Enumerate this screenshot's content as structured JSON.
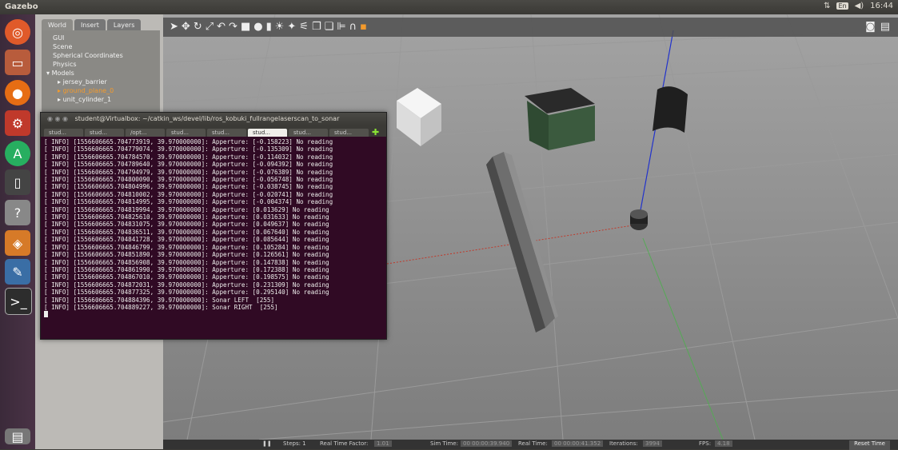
{
  "topbar": {
    "title": "Gazebo",
    "kb": "En",
    "volume": "◀)",
    "time": "16:44"
  },
  "sidebar": {
    "tabs": [
      "World",
      "Insert",
      "Layers"
    ],
    "tree": {
      "items": [
        "GUI",
        "Scene",
        "Spherical Coordinates",
        "Physics"
      ],
      "models_label": "Models",
      "models": [
        "jersey_barrier",
        "ground_plane_0",
        "unit_cylinder_1"
      ]
    }
  },
  "statusbar": {
    "steps": "Steps: 1",
    "rtf_label": "Real Time Factor:",
    "rtf": "1.01",
    "sim_label": "Sim Time:",
    "sim": "00 00:00:39.940",
    "real_label": "Real Time:",
    "real": "00 00:00:41.352",
    "iter_label": "Iterations:",
    "iter": "3994",
    "fps_label": "FPS:",
    "fps": "4.18",
    "reset": "Reset Time"
  },
  "terminal": {
    "title": "student@Virtualbox: ~/catkin_ws/devel/lib/ros_kobuki_fullrangelaserscan_to_sonar",
    "tabs": [
      "stud...",
      "stud...",
      "/opt...",
      "stud...",
      "stud...",
      "stud...",
      "stud...",
      "stud...",
      "stud..."
    ],
    "active_tab": 5,
    "lines": [
      "[ INFO] [1556606665.704773919, 39.970000000]: Apperture: [-0.158223] No reading",
      "[ INFO] [1556606665.704779074, 39.970000000]: Apperture: [-0.135309] No reading",
      "[ INFO] [1556606665.704784570, 39.970000000]: Apperture: [-0.114032] No reading",
      "[ INFO] [1556606665.704789640, 39.970000000]: Apperture: [-0.094392] No reading",
      "[ INFO] [1556606665.704794979, 39.970000000]: Apperture: [-0.076389] No reading",
      "[ INFO] [1556606665.704800090, 39.970000000]: Apperture: [-0.056748] No reading",
      "[ INFO] [1556606665.704804996, 39.970000000]: Apperture: [-0.038745] No reading",
      "[ INFO] [1556606665.704810002, 39.970000000]: Apperture: [-0.020741] No reading",
      "[ INFO] [1556606665.704814995, 39.970000000]: Apperture: [-0.004374] No reading",
      "[ INFO] [1556606665.704819994, 39.970000000]: Apperture: [0.013629] No reading",
      "[ INFO] [1556606665.704825610, 39.970000000]: Apperture: [0.031633] No reading",
      "[ INFO] [1556606665.704831075, 39.970000000]: Apperture: [0.049637] No reading",
      "[ INFO] [1556606665.704836511, 39.970000000]: Apperture: [0.067640] No reading",
      "[ INFO] [1556606665.704841728, 39.970000000]: Apperture: [0.085644] No reading",
      "[ INFO] [1556606665.704846799, 39.970000000]: Apperture: [0.105284] No reading",
      "[ INFO] [1556606665.704851890, 39.970000000]: Apperture: [0.126561] No reading",
      "[ INFO] [1556606665.704856908, 39.970000000]: Apperture: [0.147838] No reading",
      "[ INFO] [1556606665.704861990, 39.970000000]: Apperture: [0.172388] No reading",
      "[ INFO] [1556606665.704867010, 39.970000000]: Apperture: [0.198575] No reading",
      "[ INFO] [1556606665.704872031, 39.970000000]: Apperture: [0.231309] No reading",
      "[ INFO] [1556606665.704877325, 39.970000000]: Apperture: [0.295140] No reading",
      "[ INFO] [1556606665.704884396, 39.970000000]: Sonar LEFT  [255]",
      "[ INFO] [1556606665.704889227, 39.970000000]: Sonar RIGHT  [255]"
    ]
  }
}
